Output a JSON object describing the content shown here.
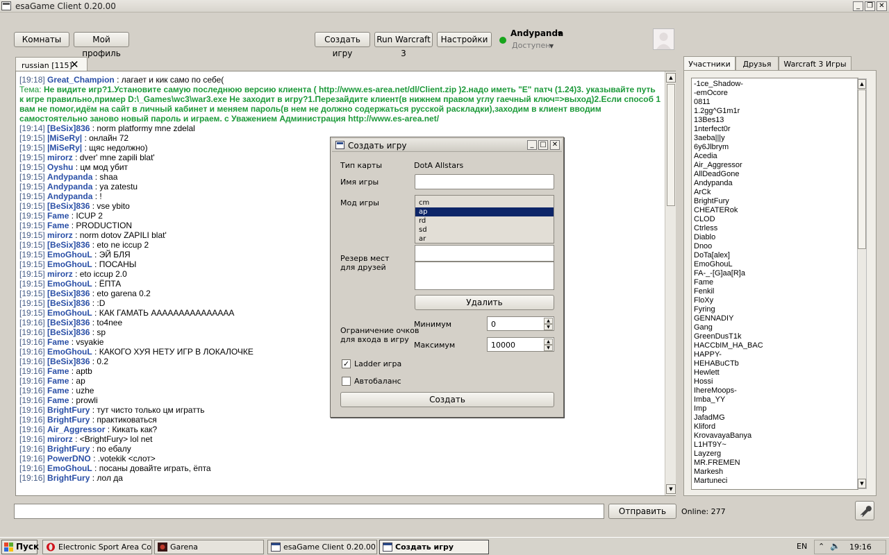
{
  "window": {
    "title": "esaGame Client 0.20.00"
  },
  "toolbar": {
    "rooms": "Комнаты",
    "profile": "Мой профиль",
    "create_game": "Создать игру",
    "run_wc3": "Run Warcraft 3",
    "settings": "Настройки"
  },
  "user": {
    "name": "Andypanda",
    "status": "Доступен"
  },
  "chat_tab": {
    "label": "russian [115]"
  },
  "topic": {
    "label": "Тема:",
    "text": "Не видите игр?1.Установите самую последнюю версию клиента ( http://www.es-area.net/dl/Client.zip )2.надо иметь \"E\" патч (1.24)3. указывайте путь к игре правильно,пример D:\\_Games\\wc3\\war3.exe Не заходит в игру?1.Перезайдите клиент(в нижнем правом углу гаечный ключ=>выход)2.Если способ 1 вам не помог,идём на сайт в личный кабинет и меняем пароль(в нем не должно содержаться русской раскладки),заходим в клиент вводим самостоятельно заново новый пароль и играем. с Уважением Администрация http://www.es-area.net/"
  },
  "chat_first": {
    "ts": "[19:18]",
    "nick": "Great_Champion",
    "text": " : лагает и кик само по себе("
  },
  "chat": [
    {
      "ts": "[19:14]",
      "nick": "[BeSix]836",
      "text": " : norm platformy mne zdelal"
    },
    {
      "ts": "[19:15]",
      "nick": "|MiSeRy|",
      "text": " : онлайн 72"
    },
    {
      "ts": "[19:15]",
      "nick": "|MiSeRy|",
      "text": " : щяс недолжно)"
    },
    {
      "ts": "[19:15]",
      "nick": "mirorz",
      "text": " : dver' mne zapili blat'"
    },
    {
      "ts": "[19:15]",
      "nick": "Oyshu",
      "text": " : цм мод убит"
    },
    {
      "ts": "[19:15]",
      "nick": "Andypanda",
      "text": " : shaa"
    },
    {
      "ts": "[19:15]",
      "nick": "Andypanda",
      "text": " : ya zatestu"
    },
    {
      "ts": "[19:15]",
      "nick": "Andypanda",
      "text": " : !"
    },
    {
      "ts": "[19:15]",
      "nick": "[BeSix]836",
      "text": " : vse ybito"
    },
    {
      "ts": "[19:15]",
      "nick": "Fame",
      "text": " : ICUP 2"
    },
    {
      "ts": "[19:15]",
      "nick": "Fame",
      "text": " : PRODUCTION"
    },
    {
      "ts": "[19:15]",
      "nick": "mirorz",
      "text": " : norm dotov ZAPILI blat'"
    },
    {
      "ts": "[19:15]",
      "nick": "[BeSix]836",
      "text": " : eto ne iccup 2"
    },
    {
      "ts": "[19:15]",
      "nick": "EmoGhouL",
      "text": " : ЭЙ БЛЯ"
    },
    {
      "ts": "[19:15]",
      "nick": "EmoGhouL",
      "text": " : ПОСАНЫ"
    },
    {
      "ts": "[19:15]",
      "nick": "mirorz",
      "text": " : eto iccup 2.0"
    },
    {
      "ts": "[19:15]",
      "nick": "EmoGhouL",
      "text": " : ЁПТА"
    },
    {
      "ts": "[19:15]",
      "nick": "[BeSix]836",
      "text": " : eto garena 0.2"
    },
    {
      "ts": "[19:15]",
      "nick": "[BeSix]836",
      "text": " : :D"
    },
    {
      "ts": "[19:15]",
      "nick": "EmoGhouL",
      "text": " : КАК ГАМАТЬ ААААААААААААААА"
    },
    {
      "ts": "[19:16]",
      "nick": "[BeSix]836",
      "text": " : to4nee"
    },
    {
      "ts": "[19:16]",
      "nick": "[BeSix]836",
      "text": " : sp"
    },
    {
      "ts": "[19:16]",
      "nick": "Fame",
      "text": " : vsyakie"
    },
    {
      "ts": "[19:16]",
      "nick": "EmoGhouL",
      "text": " : КАКОГО ХУЯ НЕТУ ИГР В ЛОКАЛОЧКЕ"
    },
    {
      "ts": "[19:16]",
      "nick": "[BeSix]836",
      "text": " : 0.2"
    },
    {
      "ts": "[19:16]",
      "nick": "Fame",
      "text": " : aptb"
    },
    {
      "ts": "[19:16]",
      "nick": "Fame",
      "text": " : ap"
    },
    {
      "ts": "[19:16]",
      "nick": "Fame",
      "text": " : uzhe"
    },
    {
      "ts": "[19:16]",
      "nick": "Fame",
      "text": " : prowli"
    },
    {
      "ts": "[19:16]",
      "nick": "BrightFury",
      "text": " : тут чисто только цм игратть"
    },
    {
      "ts": "[19:16]",
      "nick": "BrightFury",
      "text": " : практиковаться"
    },
    {
      "ts": "[19:16]",
      "nick": "Air_Aggressor",
      "text": " : Кикать как?"
    },
    {
      "ts": "[19:16]",
      "nick": "mirorz",
      "text": " : <BrightFury>  lol net"
    },
    {
      "ts": "[19:16]",
      "nick": "BrightFury",
      "text": " : по ебалу"
    },
    {
      "ts": "[19:16]",
      "nick": "PowerDNO",
      "text": " : .votekik <слот>"
    },
    {
      "ts": "[19:16]",
      "nick": "EmoGhouL",
      "text": " : посаны довайте играть, ёпта"
    },
    {
      "ts": "[19:16]",
      "nick": "BrightFury",
      "text": " : лол да"
    }
  ],
  "right_tabs": {
    "participants": "Участники",
    "friends": "Друзья",
    "games": "Warcraft 3 Игры"
  },
  "users": [
    "-1ce_Shadow-",
    "-emOcore",
    "0811",
    "1.2gg^G1m1r",
    "13Bes13",
    "1nterfect0r",
    "3aeba|||y",
    "6y6Jlbrym",
    "Acedia",
    "Air_Aggressor",
    "AllDeadGone",
    "Andypanda",
    "ArCk",
    "BrightFury",
    "CHEATERok",
    "CLOD",
    "Ctrless",
    "Diablo",
    "Dnoo",
    "DoTa[alex]",
    "EmoGhouL",
    "FA-_-[G]aa[R]a",
    "Fame",
    "Fenkil",
    "FloXy",
    "Fyring",
    "GENNADIY",
    "Gang",
    "GreenDusT1k",
    "HACCbIM_HA_BAC",
    "HAPPY-",
    "HEHABuCTb",
    "Hewlett",
    "Hossi",
    "IhereMoops-",
    "Imba_YY",
    "Imp",
    "JafadMG",
    "Kliford",
    "KrovavayaBanya",
    "L1HT9Y~",
    "Layzerg",
    "MR.FREMEN",
    "Markesh",
    "Martuneci"
  ],
  "dialog": {
    "title": "Создать игру",
    "map_type_label": "Тип карты",
    "map_type_value": "DotA Allstars",
    "game_name_label": "Имя игры",
    "game_name_value": "",
    "mode_label": "Мод игры",
    "modes": [
      "cm",
      "ap",
      "rd",
      "sd",
      "ar"
    ],
    "selected_mode": "ap",
    "reserve_label_1": "Резерв мест",
    "reserve_label_2": "для друзей",
    "delete_button": "Удалить",
    "limit_label_1": "Ограничение очков",
    "limit_label_2": "для входа в игру",
    "min_label": "Минимум",
    "min_value": "0",
    "max_label": "Максимум",
    "max_value": "10000",
    "ladder_label": "Ladder игра",
    "ladder_checked": true,
    "autobalance_label": "Автобаланс",
    "autobalance_checked": false,
    "create_button": "Создать"
  },
  "bottom": {
    "send": "Отправить",
    "online": "Online: 277",
    "input_value": ""
  },
  "taskbar": {
    "start": "Пуск",
    "items": [
      "Electronic Sport Area Co...",
      "Garena",
      "esaGame Client 0.20.00",
      "Создать игру"
    ],
    "lang": "EN",
    "time": "19:16"
  },
  "colors": {
    "nick": "#2a4fa6",
    "timestamp": "#445b86",
    "topic": "#1d9a3a",
    "selection": "#0d2568",
    "status_online": "#17a51c"
  }
}
